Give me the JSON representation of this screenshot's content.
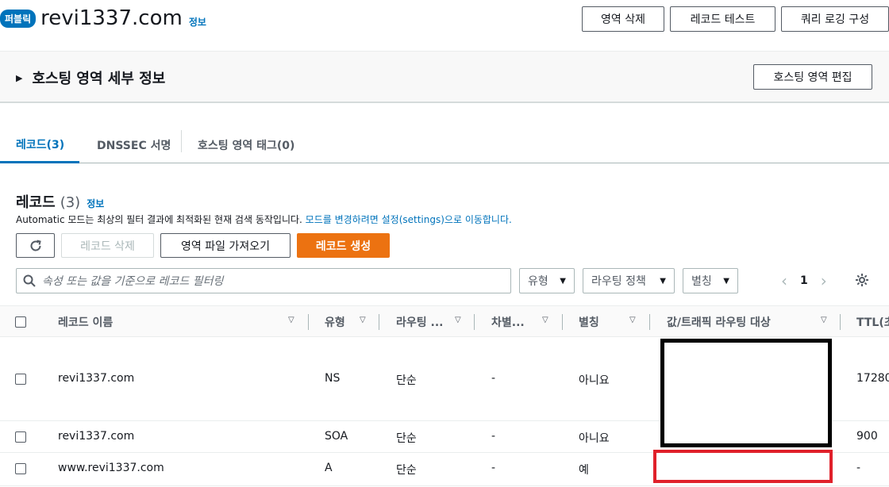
{
  "header": {
    "badge": "퍼블릭",
    "zone_name": "revi1337.com",
    "info": "정보",
    "actions": [
      "영역 삭제",
      "레코드 테스트",
      "쿼리 로깅 구성"
    ]
  },
  "details": {
    "title": "호스팅 영역 세부 정보",
    "edit_button": "호스팅 영역 편집"
  },
  "tabs": [
    {
      "label": "레코드(3)",
      "active": true
    },
    {
      "label": "DNSSEC 서명",
      "active": false
    },
    {
      "label": "호스팅 영역 태그(0)",
      "active": false
    }
  ],
  "records": {
    "title": "레코드",
    "count": "(3)",
    "info": "정보",
    "desc_text": "Automatic 모드는 최상의 필터 결과에 최적화된 현재 검색 동작입니다.",
    "desc_link": "모드를 변경하려면 설정(settings)으로 이동합니다.",
    "buttons": {
      "delete": "레코드 삭제",
      "import": "영역 파일 가져오기",
      "create": "레코드 생성"
    },
    "search_placeholder": "속성 또는 값을 기준으로 레코드 필터링",
    "filters": [
      "유형",
      "라우팅 정책",
      "별칭"
    ],
    "page": "1"
  },
  "table": {
    "columns": [
      "레코드 이름",
      "유형",
      "라우팅 ...",
      "차별...",
      "별칭",
      "값/트래픽 라우팅 대상",
      "TTL(초"
    ],
    "rows": [
      {
        "name": "revi1337.com",
        "type": "NS",
        "routing": "단순",
        "diff": "-",
        "alias": "아니요",
        "ttl": "17280"
      },
      {
        "name": "revi1337.com",
        "type": "SOA",
        "routing": "단순",
        "diff": "-",
        "alias": "아니요",
        "ttl": "900"
      },
      {
        "name": "www.revi1337.com",
        "type": "A",
        "routing": "단순",
        "diff": "-",
        "alias": "예",
        "ttl": "-"
      }
    ]
  }
}
